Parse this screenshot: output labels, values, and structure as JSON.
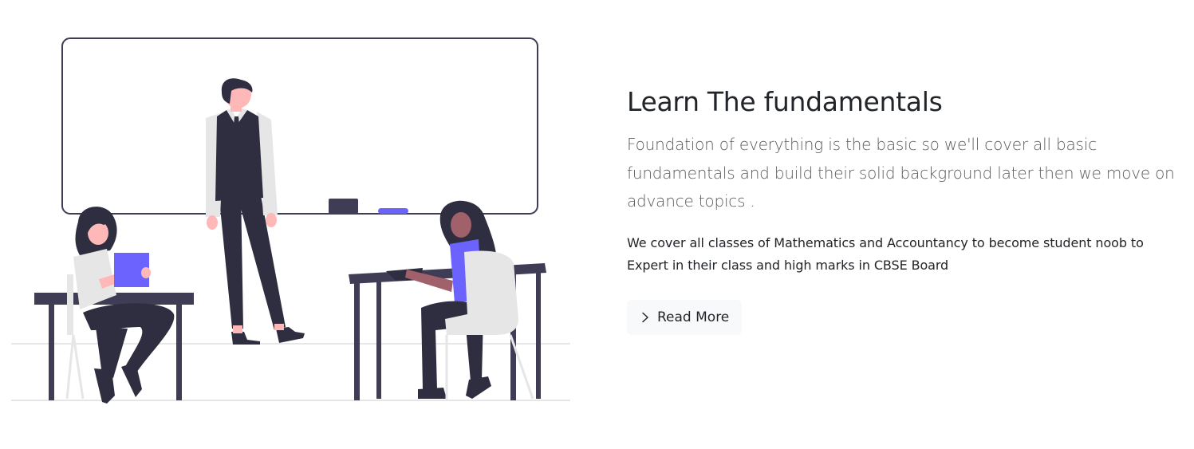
{
  "feature": {
    "title": "Learn The fundamentals",
    "lead": "Foundation of everything is the basic so we'll cover all basic fundamentals and build their solid background later then we move on advance topics .",
    "description": "We cover all classes of Mathematics and Accountancy to become student noob to Expert in their class and high marks in CBSE Board",
    "read_more_label": "Read More",
    "read_more_icon": "chevron-right-icon"
  },
  "colors": {
    "dark": "#2f2e41",
    "accent": "#6c63ff",
    "skin": "#ffb8b8",
    "light_gray": "#e6e6e6",
    "floor": "#e6e6e6"
  }
}
